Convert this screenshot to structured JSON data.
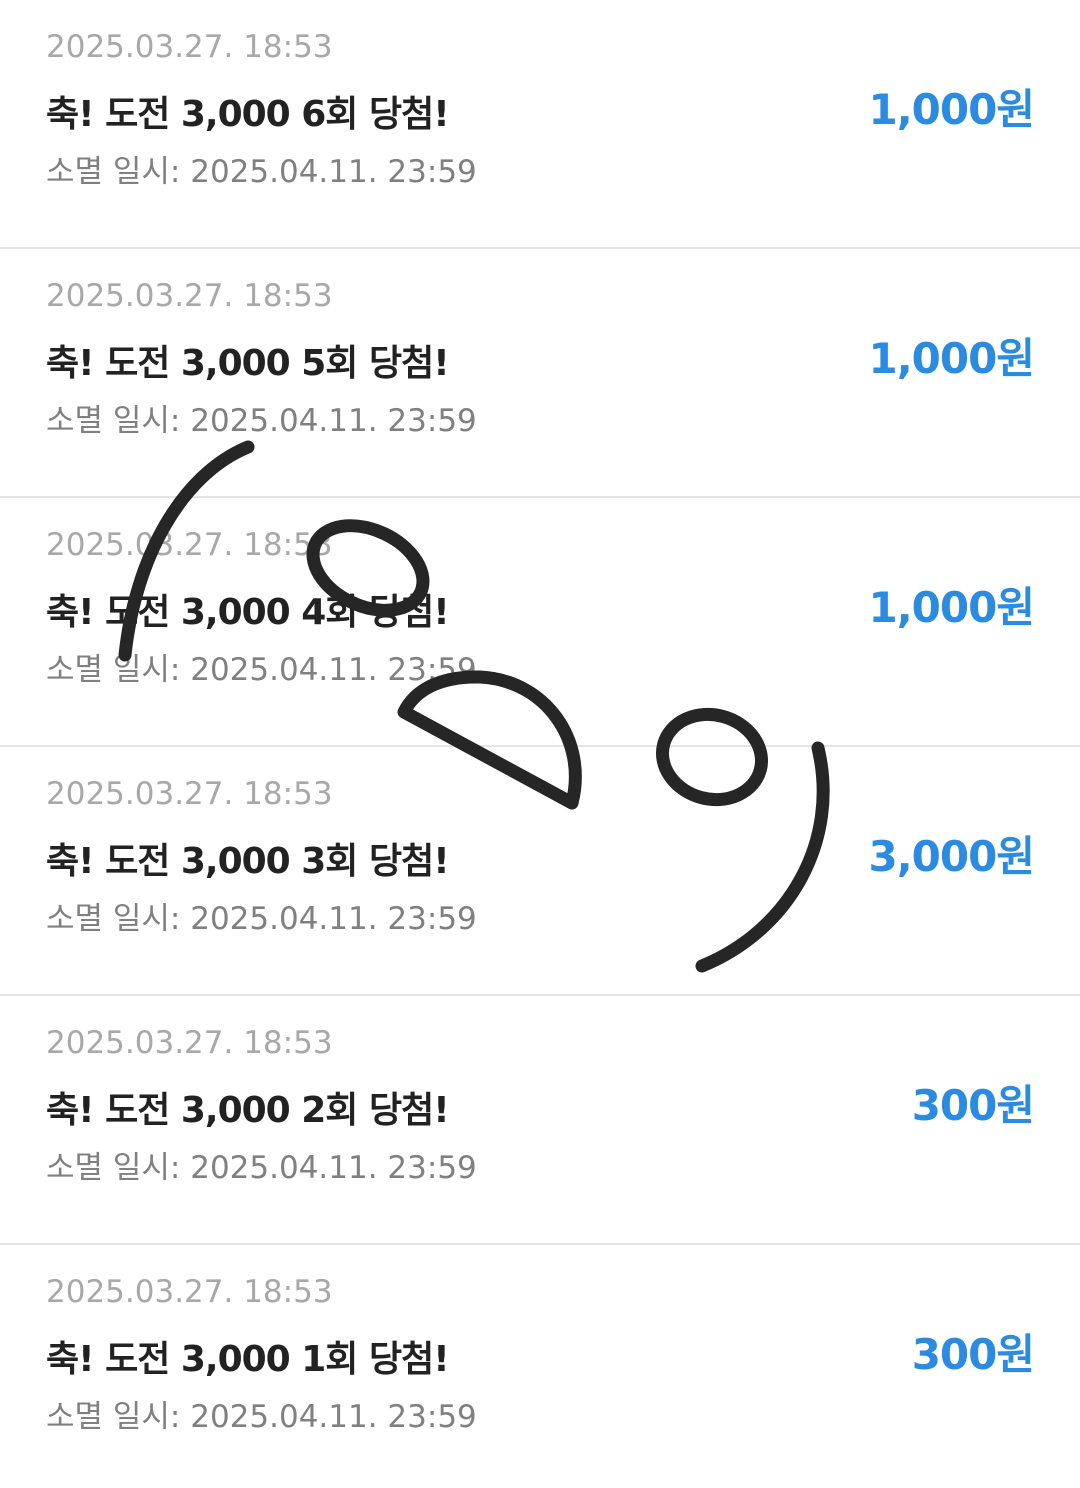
{
  "rewards": [
    {
      "date": "2025.03.27. 18:53",
      "title": "축! 도전 3,000 6회 당첨!",
      "expiry": "소멸 일시: 2025.04.11. 23:59",
      "amount": "1,000원"
    },
    {
      "date": "2025.03.27. 18:53",
      "title": "축! 도전 3,000 5회 당첨!",
      "expiry": "소멸 일시: 2025.04.11. 23:59",
      "amount": "1,000원"
    },
    {
      "date": "2025.03.27. 18:53",
      "title": "축! 도전 3,000 4회 당첨!",
      "expiry": "소멸 일시: 2025.04.11. 23:59",
      "amount": "1,000원"
    },
    {
      "date": "2025.03.27. 18:53",
      "title": "축! 도전 3,000 3회 당첨!",
      "expiry": "소멸 일시: 2025.04.11. 23:59",
      "amount": "3,000원"
    },
    {
      "date": "2025.03.27. 18:53",
      "title": "축! 도전 3,000 2회 당첨!",
      "expiry": "소멸 일시: 2025.04.11. 23:59",
      "amount": "300원"
    },
    {
      "date": "2025.03.27. 18:53",
      "title": "축! 도전 3,000 1회 당첨!",
      "expiry": "소멸 일시: 2025.04.11. 23:59",
      "amount": "300원"
    }
  ],
  "colors": {
    "amount": "#2b8be0",
    "title": "#222222",
    "date": "#a8a8a8",
    "expiry": "#808080",
    "divider": "#e4e4e4",
    "scribble": "#262626"
  },
  "overlay": {
    "icon": "hand-drawn-face-scribble"
  }
}
